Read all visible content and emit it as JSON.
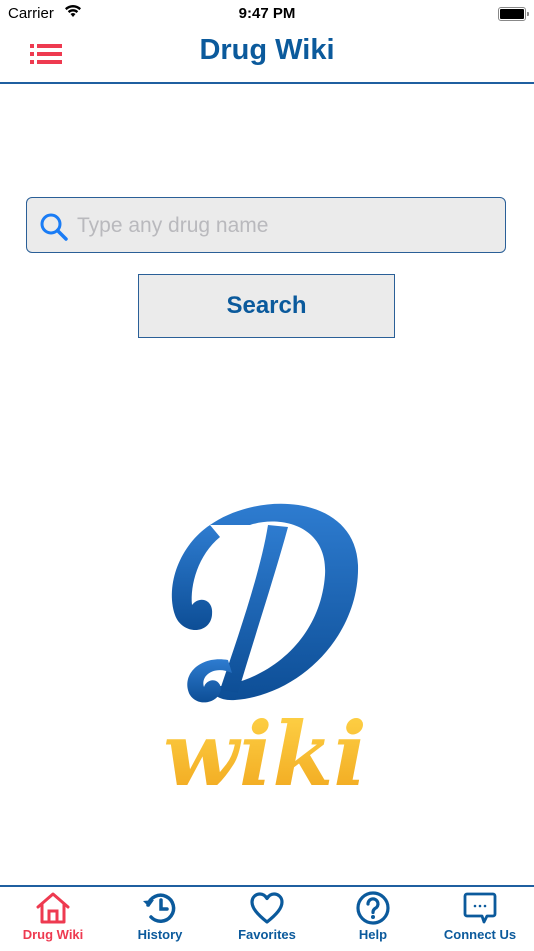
{
  "status_bar": {
    "carrier": "Carrier",
    "time": "9:47 PM"
  },
  "navbar": {
    "title": "Drug Wiki",
    "menu_icon": "list-icon"
  },
  "search": {
    "placeholder": "Type any drug name",
    "value": "",
    "button_label": "Search"
  },
  "logo": {
    "letter": "D",
    "word": "wiki"
  },
  "colors": {
    "brand_blue": "#0b5a9c",
    "accent_red": "#ee3a50",
    "logo_yellow": "#f7b928"
  },
  "tabs": [
    {
      "label": "Drug Wiki",
      "icon": "home-icon",
      "active": true
    },
    {
      "label": "History",
      "icon": "history-icon",
      "active": false
    },
    {
      "label": "Favorites",
      "icon": "heart-icon",
      "active": false
    },
    {
      "label": "Help",
      "icon": "help-icon",
      "active": false
    },
    {
      "label": "Connect Us",
      "icon": "chat-icon",
      "active": false
    }
  ]
}
